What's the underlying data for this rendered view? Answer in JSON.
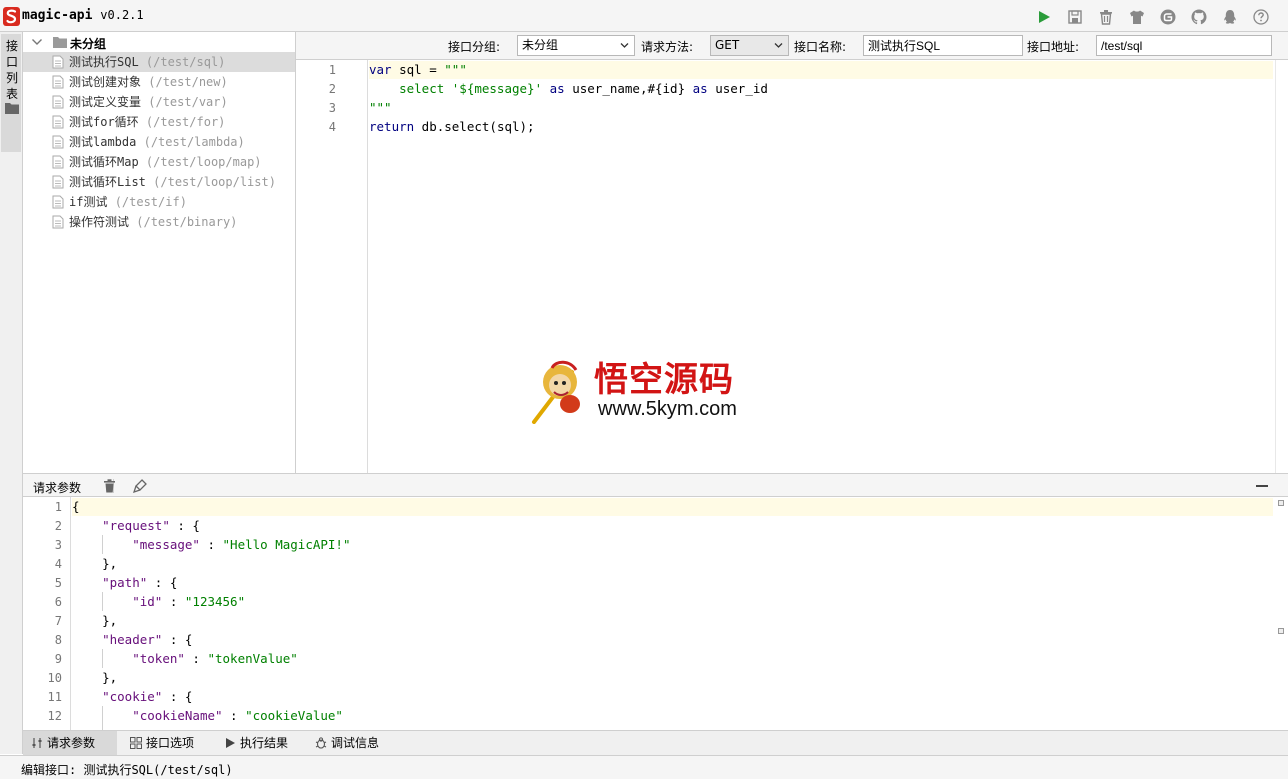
{
  "app": {
    "title": "magic-api",
    "version": "v0.2.1"
  },
  "header": {
    "icons": [
      "run-icon",
      "save-icon",
      "delete-icon",
      "skin-icon",
      "gitee-icon",
      "github-icon",
      "qq-icon",
      "help-icon"
    ],
    "accent_color": "#2a9c3a",
    "icon_color": "#888888"
  },
  "left_tab": {
    "chars": [
      "接",
      "口",
      "列",
      "表"
    ]
  },
  "tree": {
    "group_label": "未分组",
    "items": [
      {
        "name": "测试执行SQL",
        "path": "(/test/sql)"
      },
      {
        "name": "测试创建对象",
        "path": "(/test/new)"
      },
      {
        "name": "测试定义变量",
        "path": "(/test/var)"
      },
      {
        "name": "测试for循环",
        "path": "(/test/for)"
      },
      {
        "name": "测试lambda",
        "path": "(/test/lambda)"
      },
      {
        "name": "测试循环Map",
        "path": "(/test/loop/map)"
      },
      {
        "name": "测试循环List",
        "path": "(/test/loop/list)"
      },
      {
        "name": "if测试",
        "path": "(/test/if)"
      },
      {
        "name": "操作符测试",
        "path": "(/test/binary)"
      }
    ]
  },
  "toolbar": {
    "group_label": "接口分组:",
    "group_value": "未分组",
    "method_label": "请求方法:",
    "method_value": "GET",
    "name_label": "接口名称:",
    "name_value": "测试执行SQL",
    "path_label": "接口地址:",
    "path_value": "/test/sql"
  },
  "script": {
    "line_numbers": [
      "1",
      "2",
      "3",
      "4"
    ],
    "l1_kw": "var",
    "l1_rest": " sql = ",
    "l1_str": "\"\"\"",
    "l2_a": "    select '${message}' ",
    "l2_kw1": "as",
    "l2_b": " user_name,#{id} ",
    "l2_kw2": "as",
    "l2_c": " user_id",
    "l3_str": "\"\"\"",
    "l4_kw": "return",
    "l4_rest": " db.select(sql);"
  },
  "watermark": {
    "title": "悟空源码",
    "url": "www.5kym.com"
  },
  "bottom_panel": {
    "title": "请求参数",
    "line_numbers": [
      "1",
      "2",
      "3",
      "4",
      "5",
      "6",
      "7",
      "8",
      "9",
      "10",
      "11",
      "12"
    ],
    "json": {
      "l1": "{",
      "l2_key": "\"request\"",
      "l2_rest": " : {",
      "l3_key": "\"message\"",
      "l3_sep": " : ",
      "l3_val": "\"Hello MagicAPI!\"",
      "l4": "},",
      "l5_key": "\"path\"",
      "l5_rest": " : {",
      "l6_key": "\"id\"",
      "l6_sep": " : ",
      "l6_val": "\"123456\"",
      "l7": "},",
      "l8_key": "\"header\"",
      "l8_rest": " : {",
      "l9_key": "\"token\"",
      "l9_sep": " : ",
      "l9_val": "\"tokenValue\"",
      "l10": "},",
      "l11_key": "\"cookie\"",
      "l11_rest": " : {",
      "l12_key": "\"cookieName\"",
      "l12_sep": " : ",
      "l12_val": "\"cookieValue\""
    }
  },
  "bottom_tabs": [
    "请求参数",
    "接口选项",
    "执行结果",
    "调试信息"
  ],
  "status": {
    "text": "编辑接口: 测试执行SQL(/test/sql)"
  }
}
